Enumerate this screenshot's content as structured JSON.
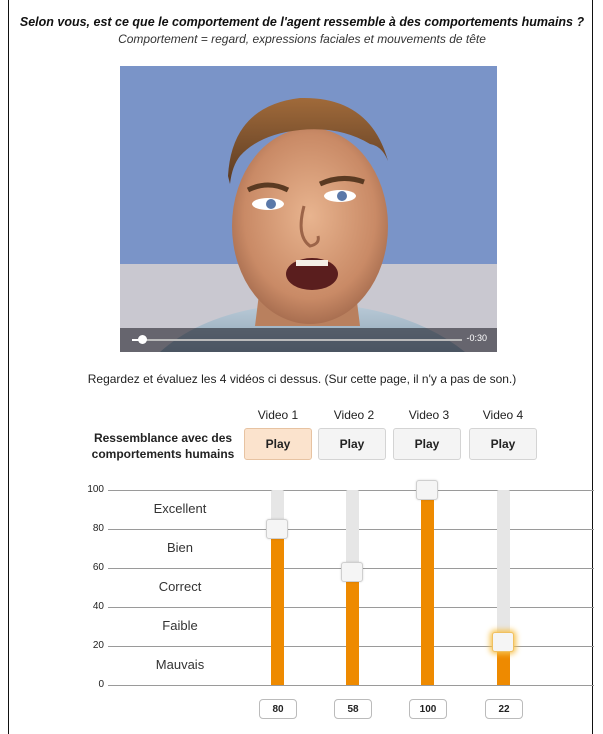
{
  "question": "Selon vous, est ce que le comportement de l'agent ressemble à des comportements humains ?",
  "subquestion": "Comportement = regard, expressions faciales et mouvements de tête",
  "video_player": {
    "time_remaining": "-0:30",
    "progress": 0.03
  },
  "instruction": "Regardez et évaluez les 4 vidéos ci dessus. (Sur cette page, il n'y a pas de son.)",
  "row_label": "Ressemblance avec des comportements humains",
  "videos": [
    {
      "label": "Video 1",
      "play_label": "Play",
      "value": 80,
      "active": true
    },
    {
      "label": "Video 2",
      "play_label": "Play",
      "value": 58,
      "active": false
    },
    {
      "label": "Video 3",
      "play_label": "Play",
      "value": 100,
      "active": false
    },
    {
      "label": "Video 4",
      "play_label": "Play",
      "value": 22,
      "active": false
    }
  ],
  "scale": {
    "ticks": [
      "100",
      "80",
      "60",
      "40",
      "20",
      "0"
    ],
    "ratings": [
      "Excellent",
      "Bien",
      "Correct",
      "Faible",
      "Mauvais"
    ]
  },
  "colors": {
    "fill": "#ee8a00",
    "video_background": "#7a94c8",
    "active_play": "#fbe3cd"
  }
}
